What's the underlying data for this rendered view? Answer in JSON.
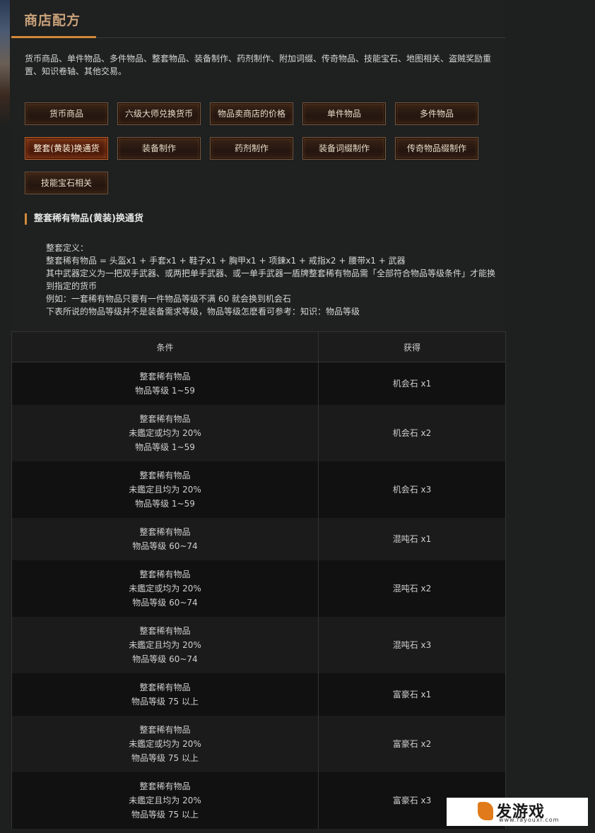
{
  "header": {
    "title": "商店配方"
  },
  "intro_text": "货币商品、单件物品、多件物品、整套物品、装备制作、药剂制作、附加词缀、传奇物品、技能宝石、地图相关、盗贼奖励重置、知识卷轴、其他交易。",
  "tabs": [
    {
      "label": "货币商品"
    },
    {
      "label": "六级大师兑换货币"
    },
    {
      "label": "物品卖商店的价格"
    },
    {
      "label": "单件物品"
    },
    {
      "label": "多件物品"
    },
    {
      "label": "整套(黄装)换通货"
    },
    {
      "label": "装备制作"
    },
    {
      "label": "药剂制作"
    },
    {
      "label": "装备词缀制作"
    },
    {
      "label": "传奇物品缀制作"
    },
    {
      "label": "技能宝石相关"
    }
  ],
  "active_tab": "整套(黄装)换通货",
  "section": {
    "title": "整套稀有物品(黄装)换通货",
    "lines": [
      "整套定义：",
      "整套稀有物品 = 头盔x1 + 手套x1 + 鞋子x1 + 胸甲x1 + 项鍊x1 + 戒指x2 + 腰带x1 + 武器",
      "其中武器定义为一把双手武器、或两把单手武器、或一单手武器一盾牌整套稀有物品需「全部符合物品等级条件」才能换到指定的货币",
      "例如：一套稀有物品只要有一件物品等级不满 60 就会换到机会石",
      "下表所说的物品等级并不是装备需求等级，物品等级怎麽看可参考：知识：物品等级"
    ]
  },
  "table": {
    "headers": {
      "condition": "条件",
      "reward": "获得"
    },
    "rows": [
      {
        "cond": [
          "整套稀有物品",
          "物品等级 1~59"
        ],
        "reward": "机会石 x1"
      },
      {
        "cond": [
          "整套稀有物品",
          "未鑑定或均为 20%",
          "物品等级 1~59"
        ],
        "reward": "机会石 x2"
      },
      {
        "cond": [
          "整套稀有物品",
          "未鑑定且均为 20%",
          "物品等级 1~59"
        ],
        "reward": "机会石 x3"
      },
      {
        "cond": [
          "整套稀有物品",
          "物品等级 60~74"
        ],
        "reward": "混吨石 x1"
      },
      {
        "cond": [
          "整套稀有物品",
          "未鑑定或均为 20%",
          "物品等级 60~74"
        ],
        "reward": "混吨石 x2"
      },
      {
        "cond": [
          "整套稀有物品",
          "未鑑定且均为 20%",
          "物品等级 60~74"
        ],
        "reward": "混吨石 x3"
      },
      {
        "cond": [
          "整套稀有物品",
          "物品等级 75 以上"
        ],
        "reward": "富豪石 x1"
      },
      {
        "cond": [
          "整套稀有物品",
          "未鑑定或均为 20%",
          "物品等级 75 以上"
        ],
        "reward": "富豪石 x2"
      },
      {
        "cond": [
          "整套稀有物品",
          "未鑑定且均为 20%",
          "物品等级 75 以上"
        ],
        "reward": "富豪石 x3"
      }
    ]
  },
  "watermark": {
    "brand": "发游戏",
    "url": "www.fayouxi.com"
  }
}
